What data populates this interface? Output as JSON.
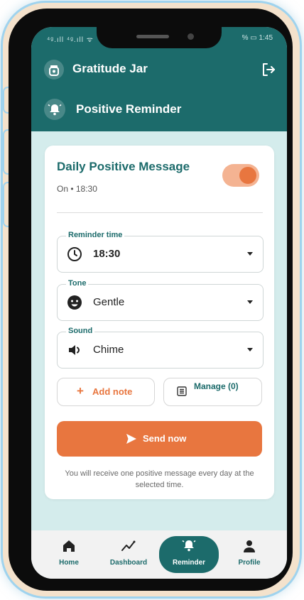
{
  "status_bar": {
    "left": "⁴ᵍ.ıll ⁴ᵍ.ıll ᯤ",
    "right": "% ▭ 1:45"
  },
  "app": {
    "title": "Gratitude Jar",
    "icon": "jar-icon",
    "logout_icon": "logout-icon"
  },
  "section": {
    "title": "Positive Reminder",
    "icon": "bell-icon"
  },
  "card": {
    "title": "Daily Positive Message",
    "subtitle": "On • 18:30",
    "toggle_on": true,
    "fields": [
      {
        "label": "Reminder time",
        "value": "18:30",
        "icon": "clock-icon"
      },
      {
        "label": "Tone",
        "value": "Gentle",
        "icon": "smiley-icon"
      },
      {
        "label": "Sound",
        "value": "Chime",
        "icon": "speaker-icon"
      }
    ],
    "add_note": "Add note",
    "manage": "Manage (0)",
    "send_now": "Send now",
    "note": "You will receive one positive message every day at the selected time."
  },
  "nav": [
    {
      "label": "Home",
      "icon": "home-icon"
    },
    {
      "label": "Dashboard",
      "icon": "chart-icon"
    },
    {
      "label": "Reminder",
      "icon": "bell-icon",
      "active": true
    },
    {
      "label": "Profile",
      "icon": "person-icon"
    }
  ],
  "colors": {
    "primary": "#1c6b6b",
    "accent": "#e8763f",
    "background": "#d4ecec"
  }
}
